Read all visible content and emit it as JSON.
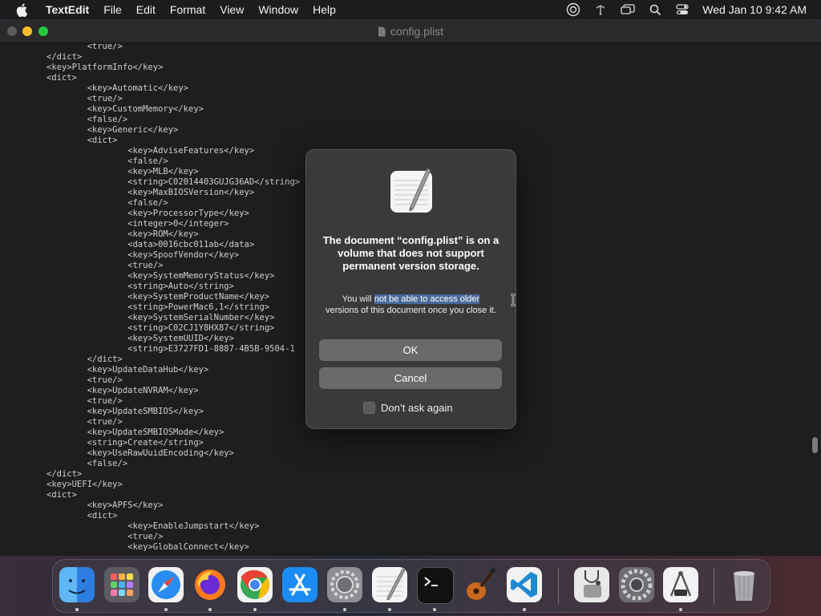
{
  "menubar": {
    "app_name": "TextEdit",
    "items": [
      "File",
      "Edit",
      "Format",
      "View",
      "Window",
      "Help"
    ],
    "clock": "Wed Jan 10  9:42 AM"
  },
  "window": {
    "title": "config.plist",
    "content": "\t<true/>\n</dict>\n<key>PlatformInfo</key>\n<dict>\n\t<key>Automatic</key>\n\t<true/>\n\t<key>CustomMemory</key>\n\t<false/>\n\t<key>Generic</key>\n\t<dict>\n\t\t<key>AdviseFeatures</key>\n\t\t<false/>\n\t\t<key>MLB</key>\n\t\t<string>C02014403GUJG36AD</string>\n\t\t<key>MaxBIOSVersion</key>\n\t\t<false/>\n\t\t<key>ProcessorType</key>\n\t\t<integer>0</integer>\n\t\t<key>ROM</key>\n\t\t<data>0016cbc011ab</data>\n\t\t<key>SpoofVendor</key>\n\t\t<true/>\n\t\t<key>SystemMemoryStatus</key>\n\t\t<string>Auto</string>\n\t\t<key>SystemProductName</key>\n\t\t<string>PowerMac6,1</string>\n\t\t<key>SystemSerialNumber</key>\n\t\t<string>C02CJ1Y8HX87</string>\n\t\t<key>SystemUUID</key>\n\t\t<string>E3727FD1-8887-4B5B-9504-1\n\t</dict>\n\t<key>UpdateDataHub</key>\n\t<true/>\n\t<key>UpdateNVRAM</key>\n\t<true/>\n\t<key>UpdateSMBIOS</key>\n\t<true/>\n\t<key>UpdateSMBIOSMode</key>\n\t<string>Create</string>\n\t<key>UseRawUuidEncoding</key>\n\t<false/>\n</dict>\n<key>UEFI</key>\n<dict>\n\t<key>APFS</key>\n\t<dict>\n\t\t<key>EnableJumpstart</key>\n\t\t<true/>\n\t\t<key>GlobalConnect</key>"
  },
  "dialog": {
    "title": "The document “config.plist” is on a volume that does not support permanent version storage.",
    "message_before": "You will ",
    "message_highlight": "not be able to access older",
    "message_after": " versions of this document once you close it.",
    "ok_label": "OK",
    "cancel_label": "Cancel",
    "checkbox_label": "Don’t ask again",
    "checkbox_checked": false
  },
  "dock": {
    "apps": [
      "Finder",
      "Launchpad",
      "Safari",
      "Firefox",
      "Chrome",
      "App Store",
      "System Preferences",
      "TextEdit",
      "Terminal",
      "GarageBand",
      "Visual Studio Code",
      "Disk Utility",
      "System Settings",
      "Instruments",
      "Trash"
    ]
  }
}
